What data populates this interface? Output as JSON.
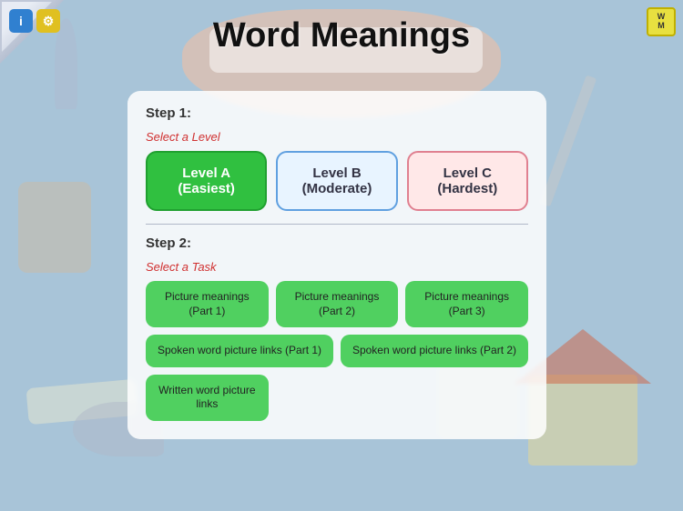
{
  "title": "Word Meanings",
  "top_icons": {
    "info_label": "i",
    "settings_label": "⚙"
  },
  "wm_icon": {
    "line1": "W",
    "line2": "M"
  },
  "step1": {
    "header": "Step 1:",
    "select_label": "Select a Level",
    "levels": [
      {
        "id": "easiest",
        "label": "Level A (Easiest)",
        "state": "active"
      },
      {
        "id": "moderate",
        "label": "Level B (Moderate)",
        "state": "moderate"
      },
      {
        "id": "hardest",
        "label": "Level C (Hardest)",
        "state": "hardest"
      }
    ]
  },
  "step2": {
    "header": "Step 2:",
    "select_label": "Select a Task",
    "tasks_row1": [
      {
        "id": "pic1",
        "label": "Picture meanings\n(Part 1)"
      },
      {
        "id": "pic2",
        "label": "Picture meanings\n(Part 2)"
      },
      {
        "id": "pic3",
        "label": "Picture meanings\n(Part 3)"
      }
    ],
    "tasks_row2": [
      {
        "id": "spoken1",
        "label": "Spoken word\npicture links (Part 1)"
      },
      {
        "id": "spoken2",
        "label": "Spoken word\npicture links (Part 2)"
      }
    ],
    "tasks_row3": [
      {
        "id": "written",
        "label": "Written word\npicture links"
      }
    ]
  },
  "colors": {
    "active_green": "#30c040",
    "task_green": "#50d060",
    "moderate_bg": "#e8f4ff",
    "hardest_bg": "#ffe8e8"
  }
}
